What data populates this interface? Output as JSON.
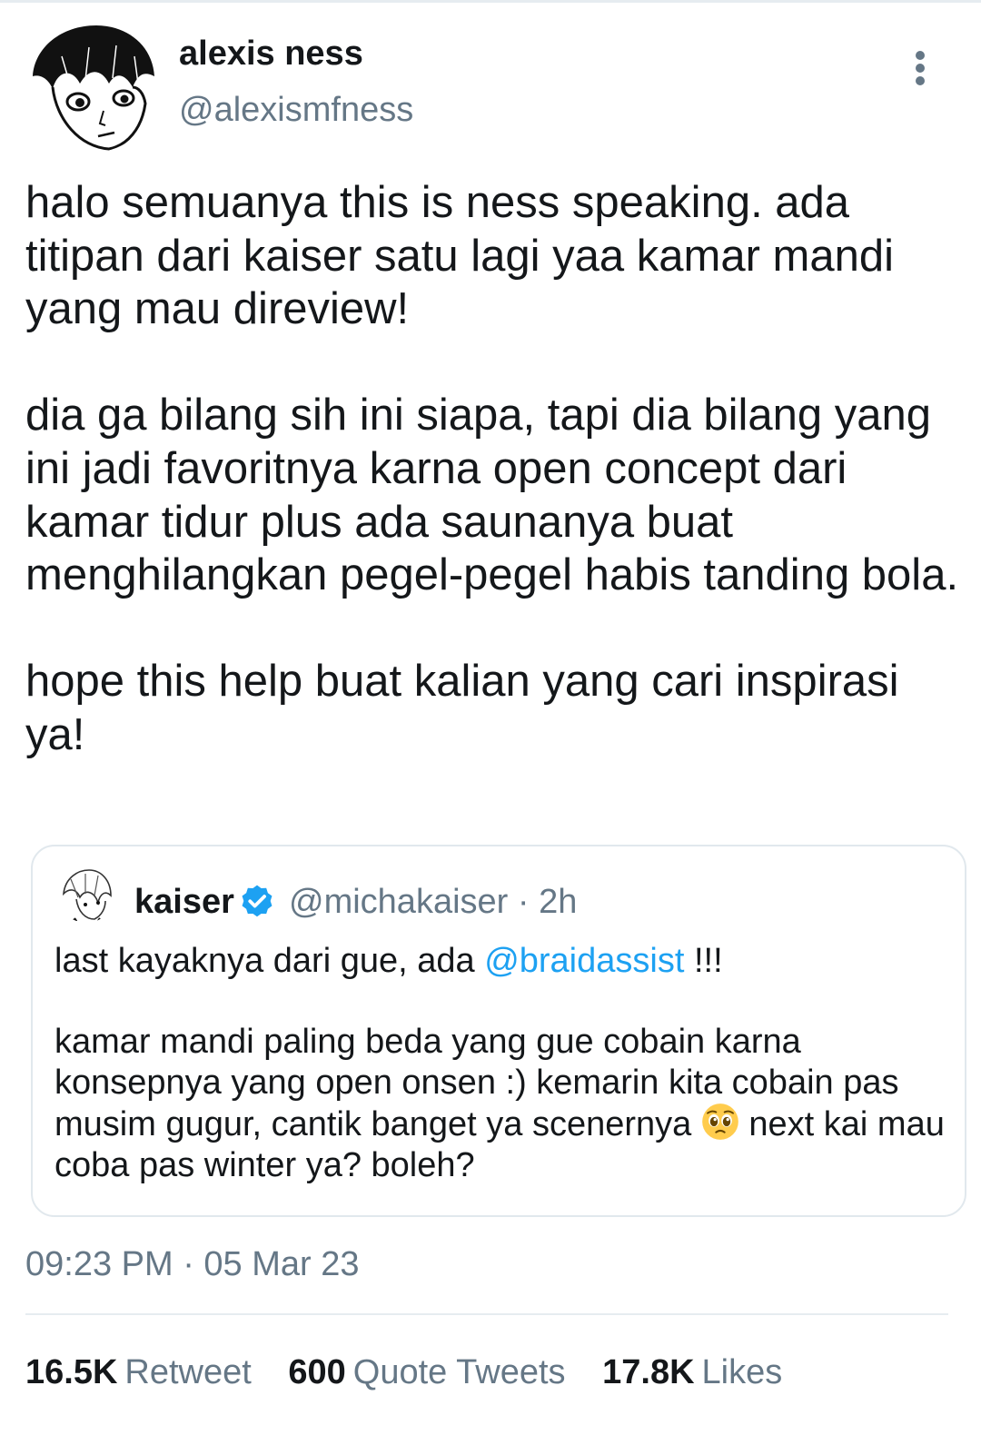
{
  "author": {
    "display_name": "alexis ness",
    "handle": "@alexismfness",
    "avatar_icon": "manga-avatar-icon"
  },
  "menu_icon": "more-vertical-icon",
  "tweet": {
    "paragraphs": [
      "halo semuanya this is ness speaking. ada titipan dari kaiser satu lagi yaa kamar mandi yang mau direview!",
      "dia ga bilang sih ini siapa, tapi dia bilang yang ini jadi favoritnya karna open concept dari kamar tidur plus ada saunanya buat menghilangkan pegel-pegel habis tanding bola.",
      "hope this help buat kalian yang cari inspirasi ya!"
    ]
  },
  "quoted": {
    "display_name": "kaiser",
    "verified_icon": "verified-badge-icon",
    "handle_time": "@michakaiser · 2h",
    "line1_prefix": "last kayaknya dari gue, ada ",
    "mention": "@braidassist",
    "line1_suffix": " !!!",
    "para2_before_emoji": "kamar mandi paling beda yang gue cobain karna konsepnya yang open onsen :) kemarin kita cobain pas musim gugur, cantik banget ya scenernya ",
    "emoji_icon": "pleading-face-icon",
    "para2_after_emoji": " next kai mau coba pas winter ya? boleh?"
  },
  "timestamp": "09:23 PM · 05 Mar 23",
  "stats": {
    "retweets": "16.5K",
    "retweets_label": "Retweet",
    "quotes": "600",
    "quotes_label": "Quote Tweets",
    "likes": "17.8K",
    "likes_label": "Likes"
  },
  "colors": {
    "text": "#14171a",
    "secondary": "#657786",
    "link": "#1da1f2",
    "border": "#e1e8ed"
  }
}
